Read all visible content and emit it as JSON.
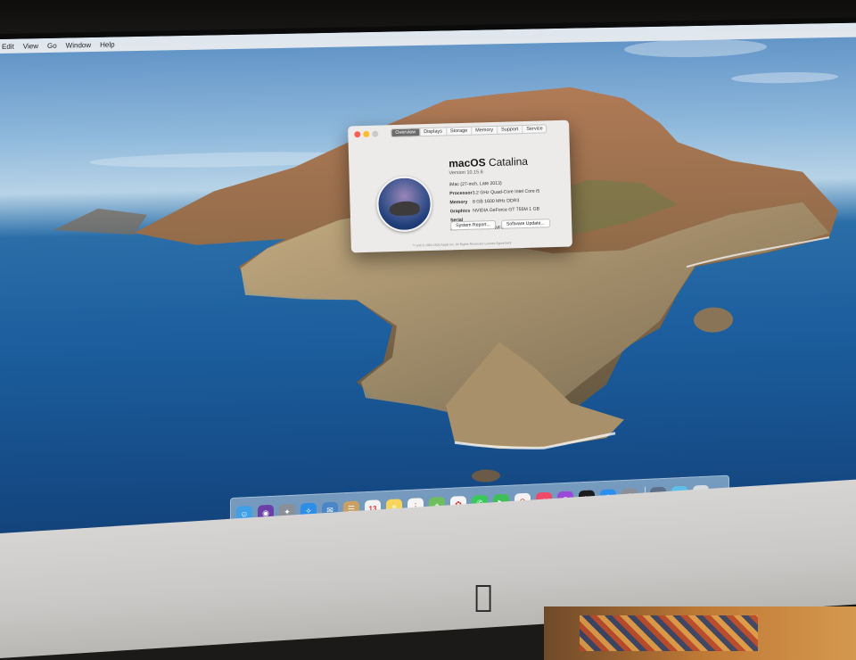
{
  "menubar": {
    "items": [
      "Edit",
      "View",
      "Go",
      "Window",
      "Help"
    ]
  },
  "about_window": {
    "tabs": [
      "Overview",
      "Displays",
      "Storage",
      "Memory",
      "Support",
      "Service"
    ],
    "active_tab": "Overview",
    "os_name_bold": "macOS",
    "os_name_rest": "Catalina",
    "version": "Version 10.15.6",
    "model": "iMac (27-inch, Late 2013)",
    "specs": [
      {
        "label": "Processor",
        "value": "3.2 GHz Quad-Core Intel Core i5"
      },
      {
        "label": "Memory",
        "value": "8 GB 1600 MHz DDR3"
      },
      {
        "label": "Graphics",
        "value": "NVIDIA GeForce GT 755M 1 GB"
      },
      {
        "label": "Serial Number",
        "value": "C02MC09WF8J4"
      }
    ],
    "buttons": {
      "system_report": "System Report...",
      "software_update": "Software Update..."
    },
    "footer": "™ and © 1983-2020 Apple Inc. All Rights Reserved. License Agreement",
    "traffic_light_colors": {
      "close": "#ff5f57",
      "minimize": "#febc2e",
      "zoom": "#c9c9c9"
    }
  },
  "dock": {
    "calendar_day": "13",
    "apps": [
      {
        "name": "finder-icon",
        "color": "#3fa0e8",
        "glyph": "☺"
      },
      {
        "name": "siri-icon",
        "color": "#6b3fa8",
        "glyph": "◉"
      },
      {
        "name": "launchpad-icon",
        "color": "#8a8f98",
        "glyph": "✦"
      },
      {
        "name": "safari-icon",
        "color": "#2d8ee8",
        "glyph": "✧"
      },
      {
        "name": "mail-icon",
        "color": "#4a86c8",
        "glyph": "✉"
      },
      {
        "name": "contacts-icon",
        "color": "#c9a063",
        "glyph": "☰"
      },
      {
        "name": "calendar-icon",
        "color": "#f2f2f2",
        "glyph": ""
      },
      {
        "name": "notes-icon",
        "color": "#f7d55a",
        "glyph": "≡"
      },
      {
        "name": "reminders-icon",
        "color": "#f5f5f5",
        "glyph": "⋮"
      },
      {
        "name": "maps-icon",
        "color": "#6fbf5e",
        "glyph": "⌖"
      },
      {
        "name": "photos-icon",
        "color": "#f4f4f4",
        "glyph": "✿"
      },
      {
        "name": "messages-icon",
        "color": "#39c85a",
        "glyph": "✆"
      },
      {
        "name": "facetime-icon",
        "color": "#3fbf58",
        "glyph": "▶"
      },
      {
        "name": "news-icon",
        "color": "#f2f2f2",
        "glyph": "⊘"
      },
      {
        "name": "music-icon",
        "color": "#f04a6a",
        "glyph": "♪"
      },
      {
        "name": "podcasts-icon",
        "color": "#9b49d8",
        "glyph": "◎"
      },
      {
        "name": "tv-icon",
        "color": "#1c1c1e",
        "glyph": "tv"
      },
      {
        "name": "app-store-icon",
        "color": "#2b8ff0",
        "glyph": "A"
      },
      {
        "name": "system-preferences-icon",
        "color": "#8a8f98",
        "glyph": "⚙"
      },
      {
        "name": "airdrop-downloads-icon",
        "color": "#5b6f86",
        "glyph": "▲"
      },
      {
        "name": "folder-icon",
        "color": "#5cc0e8",
        "glyph": "▭"
      },
      {
        "name": "trash-icon",
        "color": "#d8dde2",
        "glyph": "▯"
      }
    ]
  }
}
